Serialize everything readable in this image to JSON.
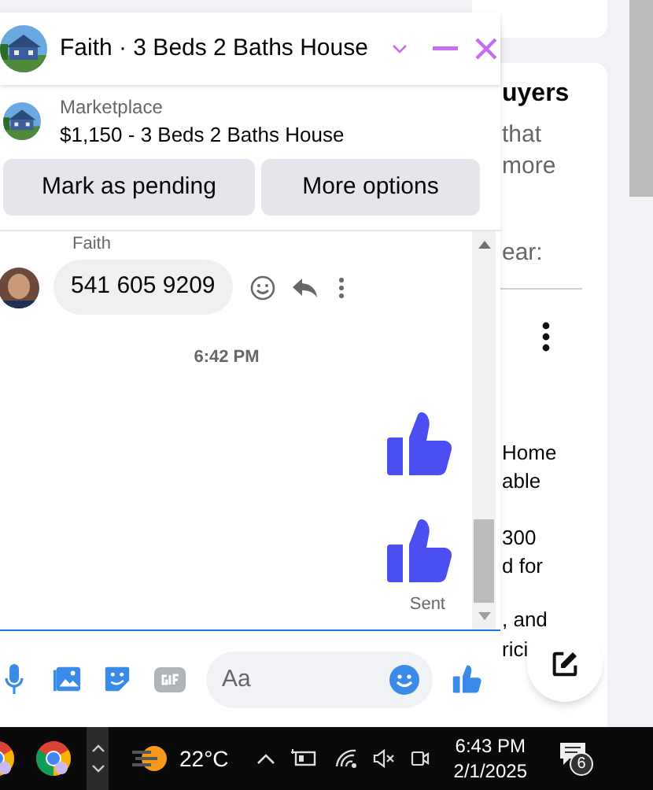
{
  "chat_header": {
    "title": "Faith · 3 Beds 2 Baths House"
  },
  "listing": {
    "source": "Marketplace",
    "summary": "$1,150 - 3 Beds 2 Baths House"
  },
  "actions": [
    "Mark as pending",
    "More options"
  ],
  "messages": [
    {
      "kind": "text",
      "sender": "Faith",
      "text": "541 605 9209"
    },
    {
      "kind": "timestamp",
      "text": "6:42 PM"
    },
    {
      "kind": "like"
    },
    {
      "kind": "like",
      "status": "Sent"
    }
  ],
  "composer": {
    "placeholder": "Aa"
  },
  "background_fragments": [
    {
      "kind": "heading",
      "text": "uyers"
    },
    {
      "kind": "muted",
      "text": "that"
    },
    {
      "kind": "muted",
      "text": "more"
    },
    {
      "kind": "muted",
      "text": "ear:"
    },
    {
      "kind": "body",
      "text": "Home"
    },
    {
      "kind": "body",
      "text": "able"
    },
    {
      "kind": "body",
      "text": "300"
    },
    {
      "kind": "body",
      "text": "d for"
    },
    {
      "kind": "body",
      "text": ", and"
    },
    {
      "kind": "body",
      "text": "rici"
    }
  ],
  "taskbar": {
    "weather": "22°C",
    "time": "6:43 PM",
    "date": "2/1/2025",
    "notifications": "6"
  }
}
